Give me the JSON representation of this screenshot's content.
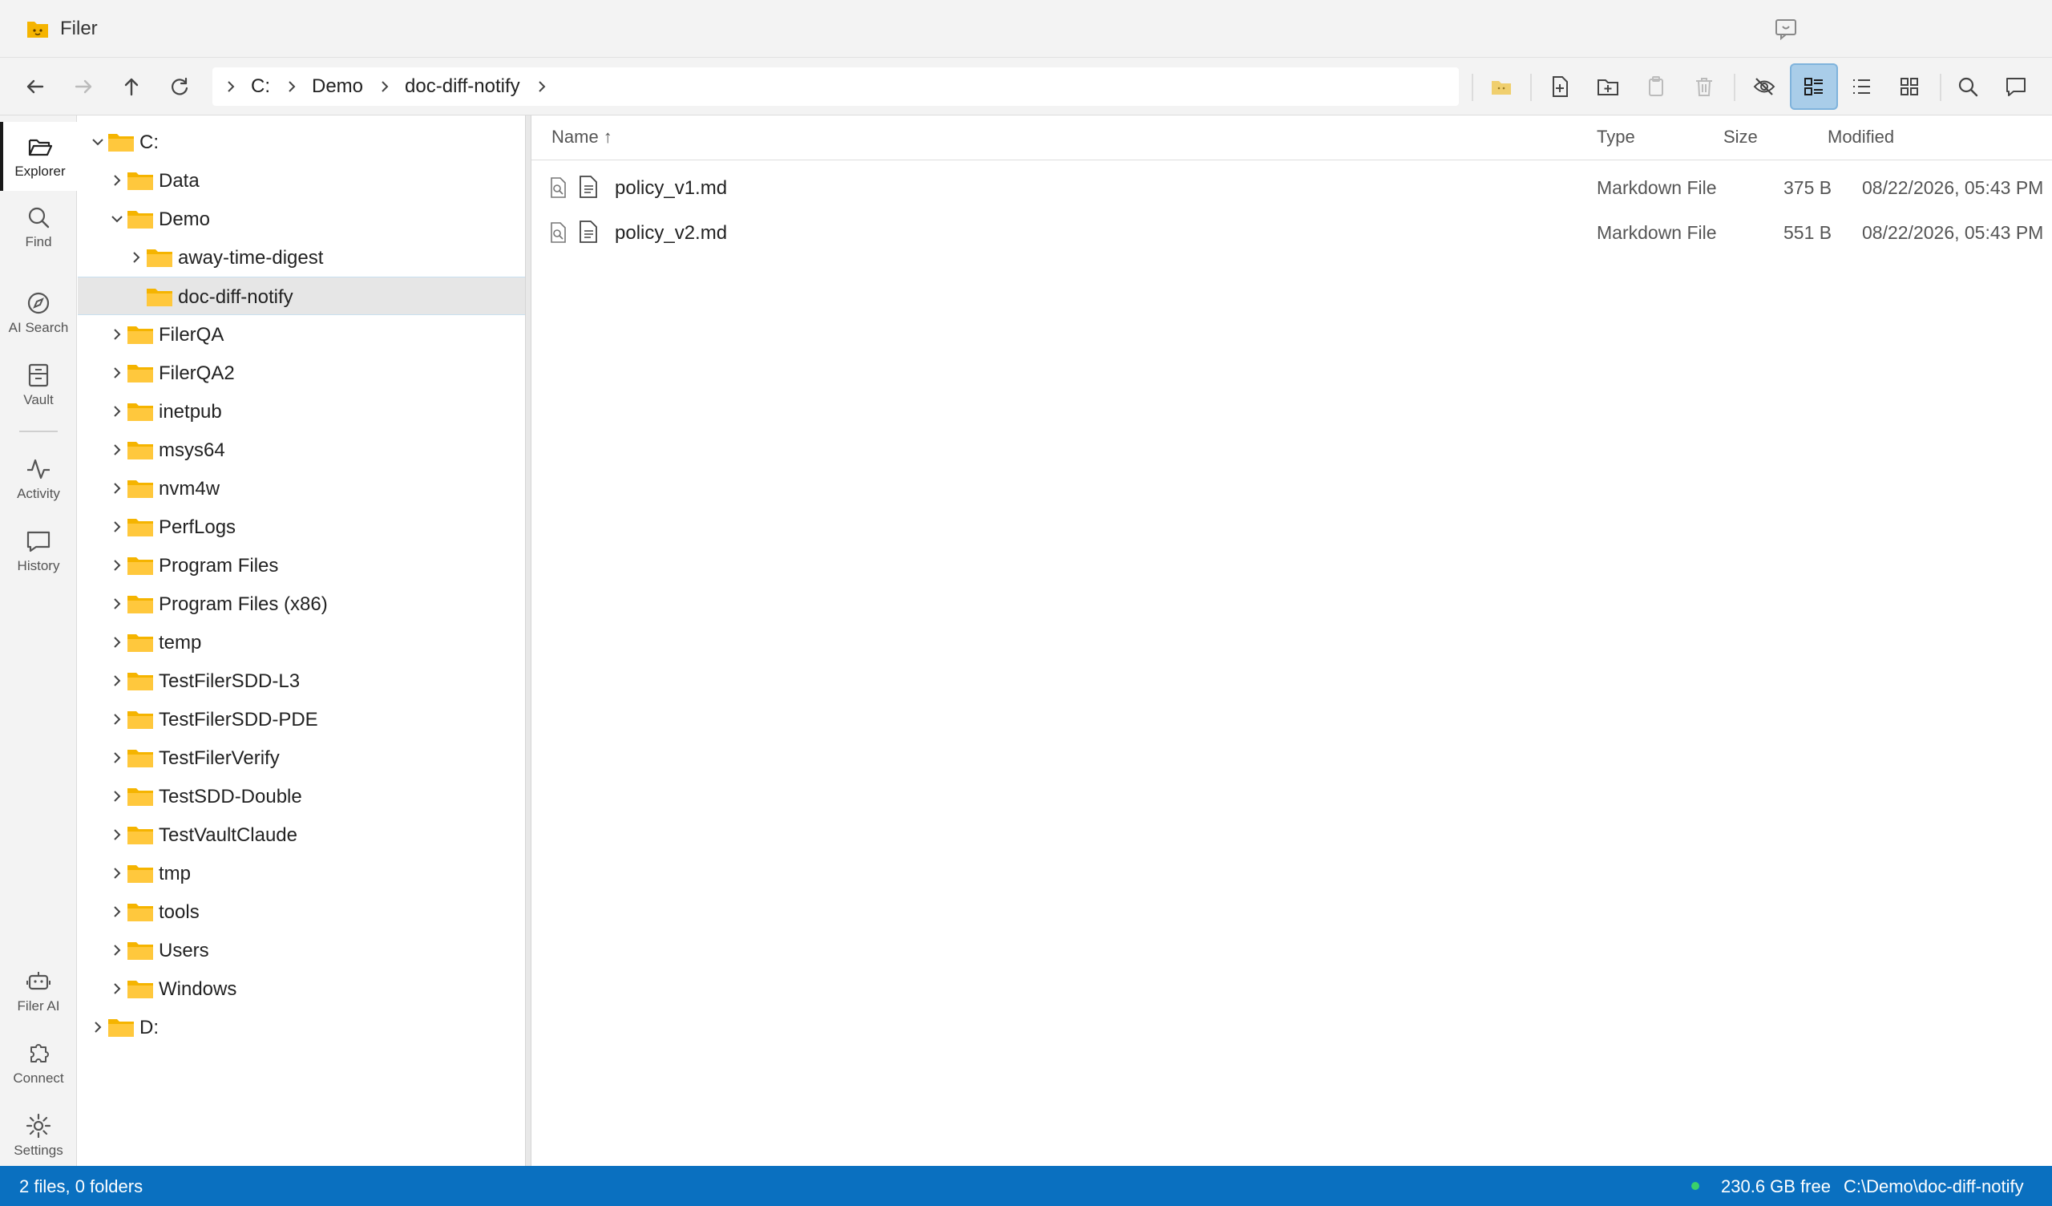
{
  "window": {
    "title": "Filer"
  },
  "breadcrumbs": [
    "C:",
    "Demo",
    "doc-diff-notify"
  ],
  "rail": {
    "top": [
      {
        "label": "Explorer",
        "icon": "folder-open-icon",
        "active": true
      },
      {
        "label": "Find",
        "icon": "search-icon"
      },
      {
        "label": "AI Search",
        "icon": "compass-icon"
      },
      {
        "label": "Vault",
        "icon": "vault-icon"
      },
      {
        "label": "Activity",
        "icon": "activity-icon"
      },
      {
        "label": "History",
        "icon": "history-icon"
      }
    ],
    "bottom": [
      {
        "label": "Filer AI",
        "icon": "robot-icon"
      },
      {
        "label": "Connect",
        "icon": "puzzle-icon"
      },
      {
        "label": "Settings",
        "icon": "gear-icon"
      }
    ]
  },
  "tree": [
    {
      "label": "C:",
      "depth": 0,
      "expanded": true
    },
    {
      "label": "Data",
      "depth": 1
    },
    {
      "label": "Demo",
      "depth": 1,
      "expanded": true
    },
    {
      "label": "away-time-digest",
      "depth": 2
    },
    {
      "label": "doc-diff-notify",
      "depth": 2,
      "selected": true,
      "leaf": true
    },
    {
      "label": "FilerQA",
      "depth": 1
    },
    {
      "label": "FilerQA2",
      "depth": 1
    },
    {
      "label": "inetpub",
      "depth": 1
    },
    {
      "label": "msys64",
      "depth": 1
    },
    {
      "label": "nvm4w",
      "depth": 1
    },
    {
      "label": "PerfLogs",
      "depth": 1
    },
    {
      "label": "Program Files",
      "depth": 1
    },
    {
      "label": "Program Files (x86)",
      "depth": 1
    },
    {
      "label": "temp",
      "depth": 1
    },
    {
      "label": "TestFilerSDD-L3",
      "depth": 1
    },
    {
      "label": "TestFilerSDD-PDE",
      "depth": 1
    },
    {
      "label": "TestFilerVerify",
      "depth": 1
    },
    {
      "label": "TestSDD-Double",
      "depth": 1
    },
    {
      "label": "TestVaultClaude",
      "depth": 1
    },
    {
      "label": "tmp",
      "depth": 1
    },
    {
      "label": "tools",
      "depth": 1
    },
    {
      "label": "Users",
      "depth": 1
    },
    {
      "label": "Windows",
      "depth": 1
    },
    {
      "label": "D:",
      "depth": 0
    }
  ],
  "columns": {
    "name": "Name ↑",
    "type": "Type",
    "size": "Size",
    "modified": "Modified"
  },
  "files": [
    {
      "name": "policy_v1.md",
      "type": "Markdown File",
      "size": "375 B",
      "modified": "08/22/2026, 05:43 PM"
    },
    {
      "name": "policy_v2.md",
      "type": "Markdown File",
      "size": "551 B",
      "modified": "08/22/2026, 05:43 PM"
    }
  ],
  "status": {
    "summary": "2 files, 0 folders",
    "free": "230.6 GB free",
    "path": "C:\\Demo\\doc-diff-notify"
  },
  "colors": {
    "accent": "#0a70c0",
    "folder": "#f5b400",
    "active_view": "#a9cde9"
  }
}
